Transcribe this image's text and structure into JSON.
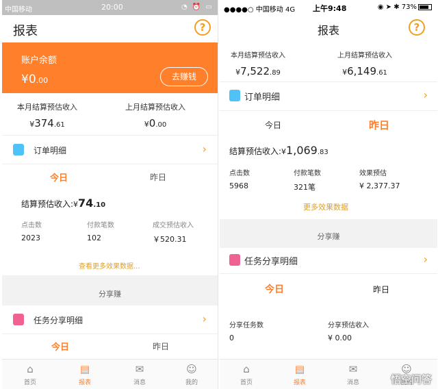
{
  "left": {
    "status": {
      "carrier": "中国移动",
      "time": "20:00"
    },
    "title": "报表",
    "help_icon": "?",
    "balance": {
      "label": "账户余额",
      "currency": "¥",
      "amount_int": "0",
      "amount_dec": ".00",
      "button": "去赚钱"
    },
    "this_month": {
      "label": "本月结算预估收入",
      "currency": "¥",
      "int": "374",
      "dec": ".61"
    },
    "last_month": {
      "label": "上月结算预估收入",
      "currency": "¥",
      "int": "0",
      "dec": ".00"
    },
    "order_detail": {
      "label": "订单明细"
    },
    "tabs": {
      "today": "今日",
      "yesterday": "昨日"
    },
    "summary": {
      "label": "结算预估收入:",
      "currency": "¥",
      "int": "74",
      "dec": ".10"
    },
    "metrics": [
      {
        "label": "点击数",
        "value": "2023"
      },
      {
        "label": "付款笔数",
        "value": "102"
      },
      {
        "label": "成交预估收入",
        "value": "￥520.31"
      }
    ],
    "more": "查看更多效果数据...",
    "share_band": "分享赚",
    "task_share": {
      "label": "任务分享明细"
    },
    "tabs2": {
      "today": "今日",
      "yesterday": "昨日"
    },
    "tabbar": [
      {
        "label": "首页",
        "icon": "home-icon"
      },
      {
        "label": "报表",
        "icon": "report-icon"
      },
      {
        "label": "消息",
        "icon": "mail-icon"
      },
      {
        "label": "我的",
        "icon": "user-icon"
      }
    ]
  },
  "right": {
    "status": {
      "carrier": "●●●●○ 中国移动  4G",
      "time": "上午9:48",
      "battery": "73%"
    },
    "title": "报表",
    "help_icon": "?",
    "this_month": {
      "label": "本月结算预估收入",
      "currency": "¥",
      "int": "7,522",
      "dec": ".89"
    },
    "last_month": {
      "label": "上月结算预估收入",
      "currency": "¥",
      "int": "6,149",
      "dec": ".61"
    },
    "order_detail": {
      "label": "订单明细"
    },
    "tabs": {
      "today": "今日",
      "yesterday": "昨日"
    },
    "summary": {
      "label": "结算预估收入:",
      "currency": "¥",
      "int": "1,069",
      "dec": ".83"
    },
    "metrics": [
      {
        "label": "点击数",
        "value": "5968"
      },
      {
        "label": "付款笔数",
        "value": "321笔"
      },
      {
        "label": "效果预估",
        "value": "¥ 2,377.37"
      }
    ],
    "more": "更多效果数据",
    "share_band": "分享赚",
    "task_share": {
      "label": "任务分享明细"
    },
    "tabs2": {
      "today": "今日",
      "yesterday": "昨日"
    },
    "share_metrics": [
      {
        "label": "分享任务数",
        "value": "0"
      },
      {
        "label": "分享预估收入",
        "value": "¥ 0.00"
      }
    ],
    "tabbar": [
      {
        "label": "首页",
        "icon": "home-icon"
      },
      {
        "label": "报表",
        "icon": "report-icon"
      },
      {
        "label": "消息",
        "icon": "mail-icon"
      },
      {
        "label": "我的",
        "icon": "user-icon"
      }
    ],
    "watermark": "悟空问答"
  },
  "colors": {
    "accent": "#ff7f2a",
    "gold": "#f0a020",
    "blue_icon": "#4fc3f7",
    "pink_icon": "#f06292"
  }
}
